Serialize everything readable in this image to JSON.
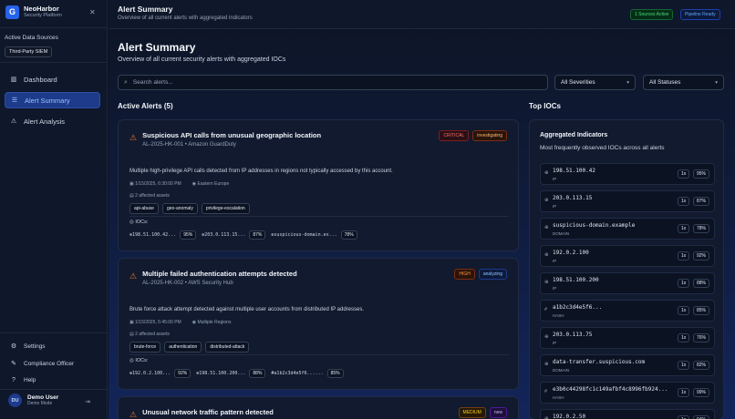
{
  "app": {
    "name": "NeoHarbor",
    "subtitle": "Security Platform",
    "logo_letter": "G"
  },
  "sidebar": {
    "sources_title": "Active Data Sources",
    "sources": [
      "Third-Party SIEM"
    ],
    "nav": [
      {
        "label": "Dashboard",
        "icon": "bar-chart-icon",
        "active": false
      },
      {
        "label": "Alert Summary",
        "icon": "list-icon",
        "active": true
      },
      {
        "label": "Alert Analysis",
        "icon": "warning-triangle-icon",
        "active": false
      }
    ],
    "bottom": [
      {
        "label": "Settings",
        "icon": "gear-icon"
      },
      {
        "label": "Compliance Officer",
        "icon": "wrench-icon"
      },
      {
        "label": "Help",
        "icon": "help-circle-icon"
      }
    ],
    "user": {
      "initials": "DU",
      "name": "Demo User",
      "role": "Demo Mode"
    }
  },
  "topbar": {
    "title": "Alert Summary",
    "subtitle": "Overview of all current alerts with aggregated indicators",
    "status_sources": "1 Sources Active",
    "status_pipeline": "Pipeline Ready"
  },
  "page": {
    "title": "Alert Summary",
    "subtitle": "Overview of all current security alerts with aggregated IOCs",
    "search_placeholder": "Search alerts...",
    "severity_filter": "All Severities",
    "status_filter": "All Statuses",
    "alerts_heading": "Active Alerts (5)",
    "iocs_heading": "Top IOCs"
  },
  "alerts": [
    {
      "title": "Suspicious API calls from unusual geographic location",
      "meta": "AL-2025-HK-001 • Amazon GuardDuty",
      "severity": "CRITICAL",
      "status": "investigating",
      "description": "Multiple high-privilege API calls detected from IP addresses in regions not typically accessed by this account.",
      "time": "1/15/2025, 6:30:00 PM",
      "location": "Eastern Europe",
      "assets": "2 affected assets",
      "tags": [
        "api-abuse",
        "geo-anomaly",
        "privilege-escalation"
      ],
      "iocs_label": "IOCs:",
      "iocs": [
        {
          "value": "198.51.100.42...",
          "confidence": "95%"
        },
        {
          "value": "203.0.113.15...",
          "confidence": "87%"
        },
        {
          "value": "suspicious-domain.ex...",
          "confidence": "78%"
        }
      ]
    },
    {
      "title": "Multiple failed authentication attempts detected",
      "meta": "AL-2025-HK-002 • AWS Security Hub",
      "severity": "HIGH",
      "status": "analyzing",
      "description": "Brute force attack attempt detected against multiple user accounts from distributed IP addresses.",
      "time": "1/15/2025, 5:45:00 PM",
      "location": "Multiple Regions",
      "assets": "2 affected assets",
      "tags": [
        "brute-force",
        "authentication",
        "distributed-attack"
      ],
      "iocs_label": "IOCs:",
      "iocs": [
        {
          "value": "192.0.2.100...",
          "confidence": "92%"
        },
        {
          "value": "198.51.100.200...",
          "confidence": "88%"
        },
        {
          "value": "a1b2c3d4e5f6......",
          "confidence": "85%"
        }
      ]
    },
    {
      "title": "Unusual network traffic pattern detected",
      "severity": "MEDIUM",
      "status": "new"
    }
  ],
  "ioc_panel": {
    "title": "Aggregated Indicators",
    "subtitle": "Most frequently observed IOCs across all alerts",
    "items": [
      {
        "value": "198.51.100.42",
        "type": "IP",
        "count": "1x",
        "confidence": "95%"
      },
      {
        "value": "203.0.113.15",
        "type": "IP",
        "count": "1x",
        "confidence": "87%"
      },
      {
        "value": "suspicious-domain.example",
        "type": "DOMAIN",
        "count": "1x",
        "confidence": "78%"
      },
      {
        "value": "192.0.2.100",
        "type": "IP",
        "count": "1x",
        "confidence": "92%"
      },
      {
        "value": "198.51.100.200",
        "type": "IP",
        "count": "1x",
        "confidence": "88%"
      },
      {
        "value": "a1b2c3d4e5f6...",
        "type": "HASH",
        "count": "1x",
        "confidence": "85%"
      },
      {
        "value": "203.0.113.75",
        "type": "IP",
        "count": "1x",
        "confidence": "76%"
      },
      {
        "value": "data-transfer.suspicious.com",
        "type": "DOMAIN",
        "count": "1x",
        "confidence": "82%"
      },
      {
        "value": "e3b0c44298fc1c149afbf4c8996fb924...",
        "type": "HASH",
        "count": "1x",
        "confidence": "99%"
      },
      {
        "value": "192.0.2.50",
        "type": "IP",
        "count": "1x",
        "confidence": "94%"
      }
    ]
  },
  "colors": {
    "accent": "#2563eb",
    "critical": "#f87171",
    "high": "#fb923c",
    "medium": "#facc15"
  }
}
